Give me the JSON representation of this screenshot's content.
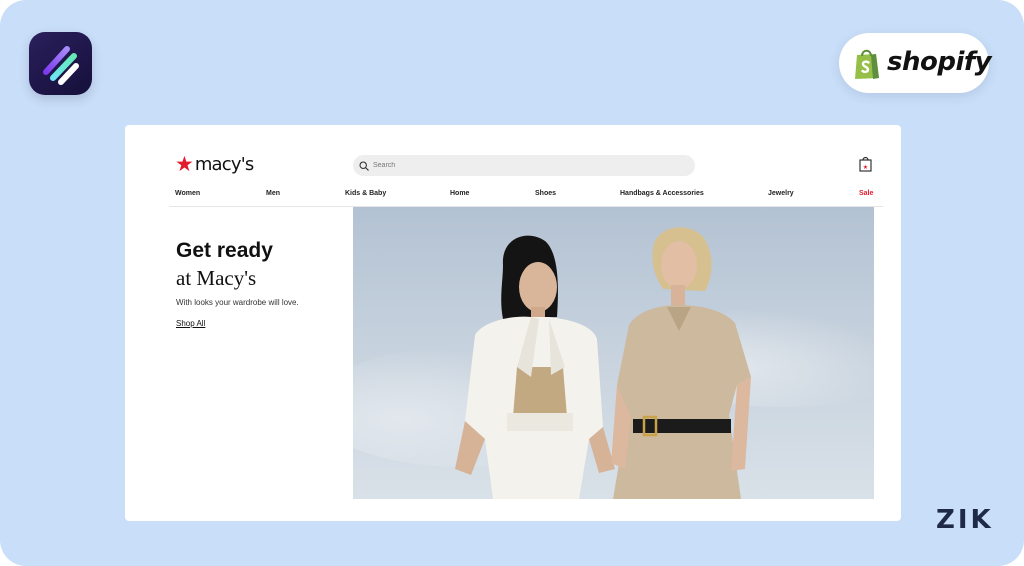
{
  "shopify": {
    "wordmark": "shopify"
  },
  "watermark": {
    "text": "ZIK"
  },
  "site": {
    "logo_text": "macy's",
    "search": {
      "placeholder": "Search"
    },
    "nav": [
      "Women",
      "Men",
      "Kids & Baby",
      "Home",
      "Shoes",
      "Handbags & Accessories",
      "Jewelry",
      "Sale"
    ],
    "hero": {
      "title": "Get ready",
      "subtitle": "at Macy's",
      "tagline": "With looks your wardrobe will love.",
      "link": "Shop All"
    }
  },
  "colors": {
    "background": "#c9def8",
    "macys_red": "#e21a2c",
    "shopify_green": "#95bf47",
    "app_icon_bg": "#1c1547"
  },
  "icons": [
    "app-logo-icon",
    "shopify-bag-icon",
    "search-icon",
    "shopping-bag-icon",
    "macys-star-icon"
  ]
}
